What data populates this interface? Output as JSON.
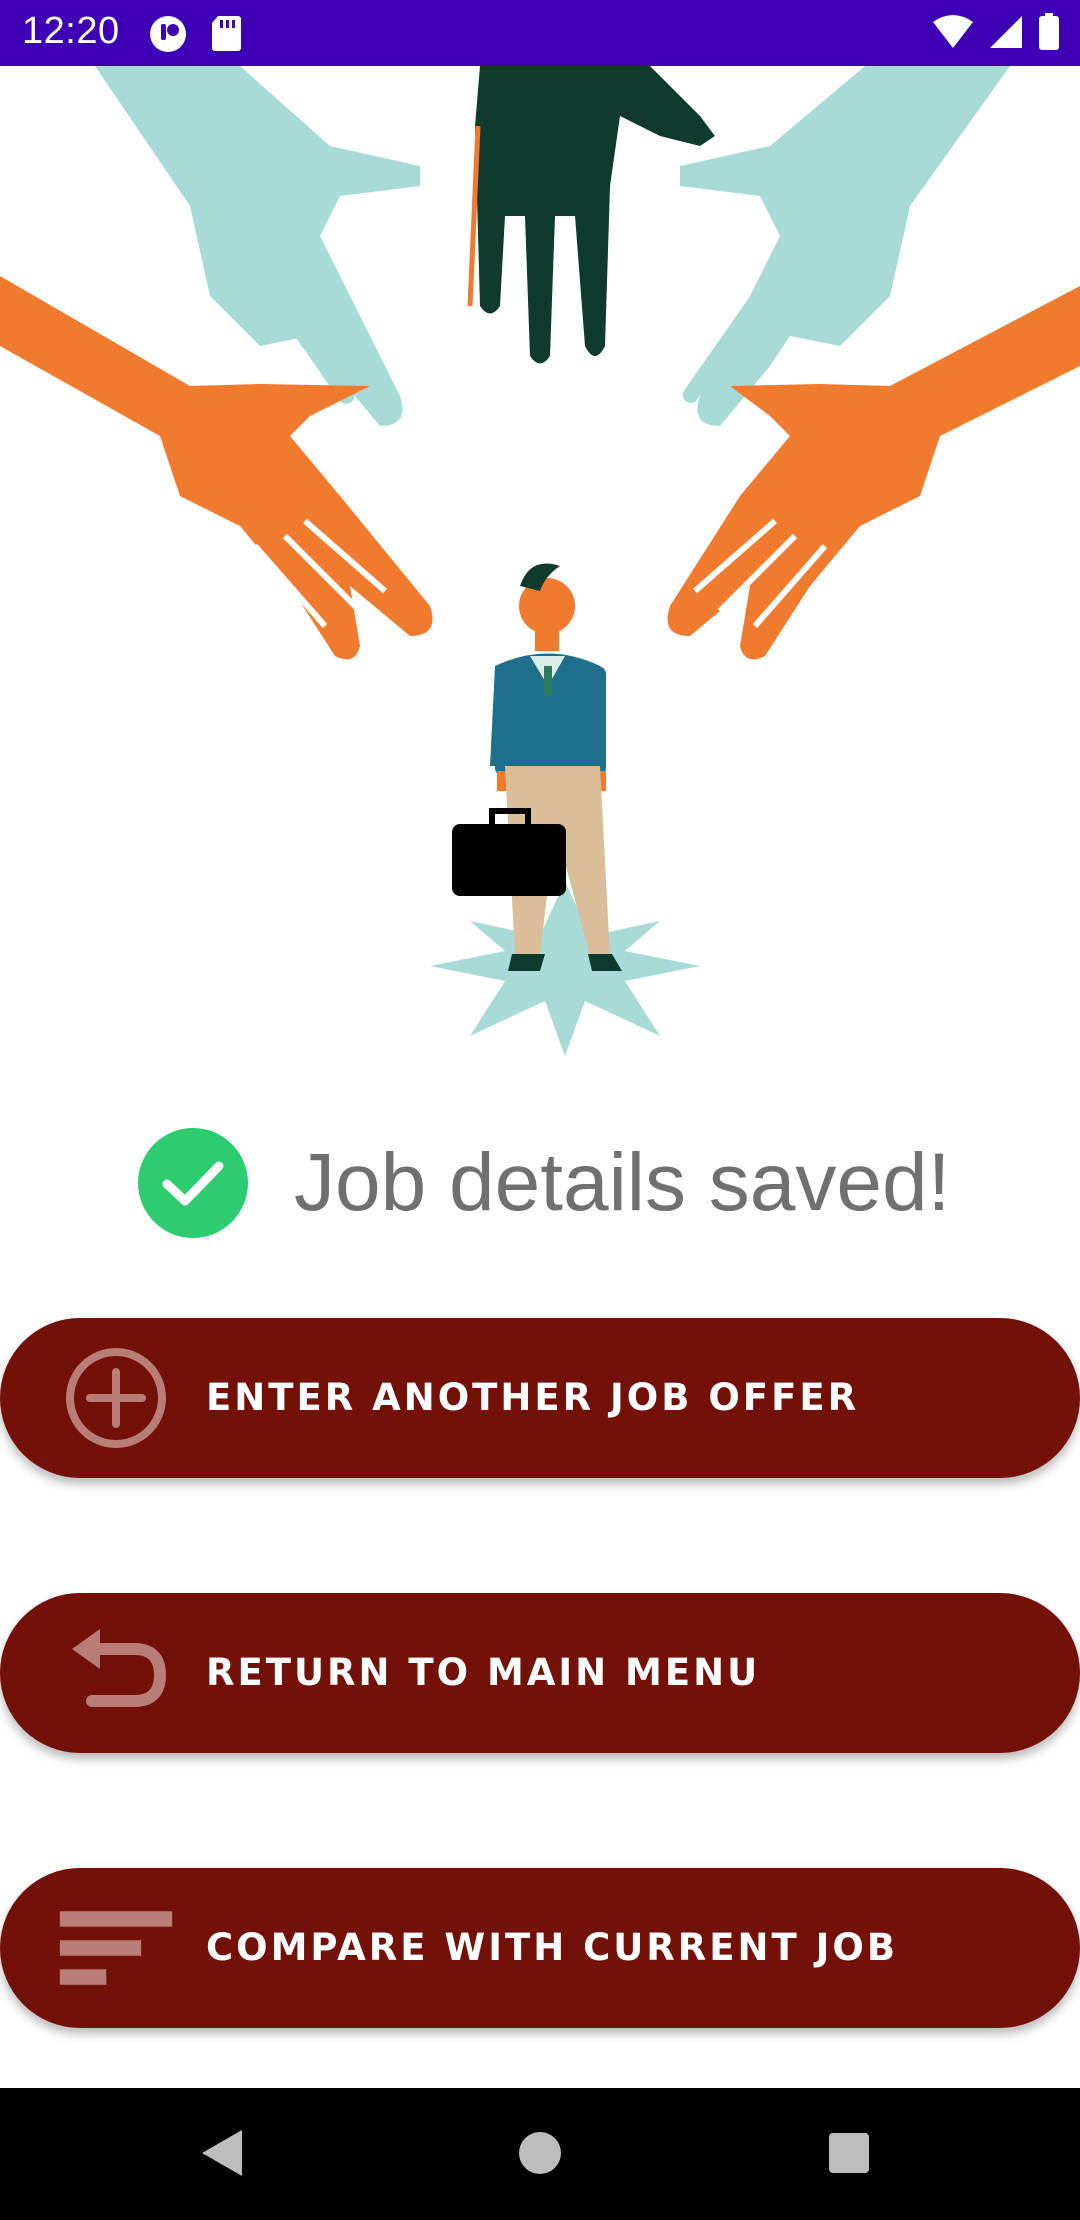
{
  "status_bar": {
    "time": "12:20",
    "left_icons": [
      "app-notification-icon",
      "sd-card-icon"
    ],
    "right_icons": [
      "wifi-icon",
      "cell-signal-icon",
      "battery-icon"
    ],
    "background_color": "#3d00b4"
  },
  "illustration": {
    "description_icon": "job-seeker-hands-illustration",
    "colors": [
      "#a8dbd5",
      "#f07a2d",
      "#0e3b2e"
    ]
  },
  "confirmation": {
    "icon": "check-circle-icon",
    "icon_color": "#2ecc71",
    "message": "Job details saved!"
  },
  "actions": [
    {
      "label": "ENTER ANOTHER JOB OFFER",
      "icon": "add-circle-icon"
    },
    {
      "label": "RETURN TO MAIN MENU",
      "icon": "undo-arrow-icon"
    },
    {
      "label": "COMPARE WITH CURRENT JOB",
      "icon": "sort-lines-icon"
    }
  ],
  "button_color": "#731007",
  "nav_bar": {
    "items": [
      "back-icon",
      "home-icon",
      "recents-icon"
    ]
  }
}
